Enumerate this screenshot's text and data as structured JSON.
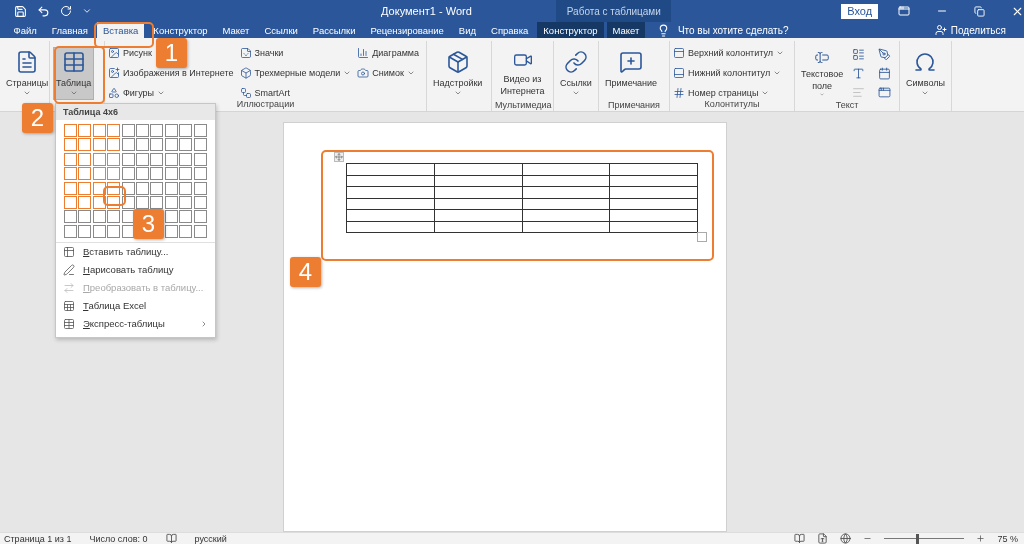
{
  "title_bar": {
    "title": "Документ1  -  Word",
    "context_label": "Работа с таблицами",
    "signin": "Вход"
  },
  "tabs": [
    {
      "label": "Файл",
      "selected": false,
      "context": false
    },
    {
      "label": "Главная",
      "selected": false,
      "context": false
    },
    {
      "label": "Вставка",
      "selected": true,
      "context": false
    },
    {
      "label": "Конструктор",
      "selected": false,
      "context": false
    },
    {
      "label": "Макет",
      "selected": false,
      "context": false
    },
    {
      "label": "Ссылки",
      "selected": false,
      "context": false
    },
    {
      "label": "Рассылки",
      "selected": false,
      "context": false
    },
    {
      "label": "Рецензирование",
      "selected": false,
      "context": false
    },
    {
      "label": "Вид",
      "selected": false,
      "context": false
    },
    {
      "label": "Справка",
      "selected": false,
      "context": false
    },
    {
      "label": "Конструктор",
      "selected": false,
      "context": true
    },
    {
      "label": "Макет",
      "selected": false,
      "context": true
    }
  ],
  "tell_me": "Что вы хотите сделать?",
  "share": "Поделиться",
  "ribbon_groups": [
    {
      "columns": [
        [
          {
            "kind": "large",
            "label": "Страницы",
            "caret": true,
            "pressed": false
          }
        ]
      ]
    },
    {
      "columns": [
        [
          {
            "kind": "large",
            "label": "Таблица",
            "caret": true,
            "pressed": true
          }
        ]
      ]
    },
    {
      "label": "Иллюстрации",
      "columns": [
        [
          {
            "kind": "small",
            "label": "Рисунк",
            "caret": false
          },
          {
            "kind": "small",
            "label": "Изображения в Интернете",
            "caret": false
          },
          {
            "kind": "small",
            "label": "Фигуры",
            "caret": true
          }
        ],
        [
          {
            "kind": "small",
            "label": "Значки",
            "caret": false
          },
          {
            "kind": "small",
            "label": "Трехмерные модели",
            "caret": true
          },
          {
            "kind": "small",
            "label": "SmartArt",
            "caret": false
          }
        ],
        [
          {
            "kind": "small",
            "label": "Диаграмма",
            "caret": false
          },
          {
            "kind": "small",
            "label": "Снимок",
            "caret": true
          }
        ]
      ]
    },
    {
      "columns": [
        [
          {
            "kind": "large",
            "label": "Надстройки",
            "caret": true,
            "pressed": false
          }
        ]
      ]
    },
    {
      "label": "Мультимедиа",
      "columns": [
        [
          {
            "kind": "large",
            "label": "Видео из Интернета",
            "caret": false,
            "pressed": false
          }
        ]
      ]
    },
    {
      "columns": [
        [
          {
            "kind": "large",
            "label": "Ссылки",
            "caret": true,
            "pressed": false
          }
        ]
      ]
    },
    {
      "label": "Примечания",
      "columns": [
        [
          {
            "kind": "large",
            "label": "Примечание",
            "caret": false,
            "pressed": false
          }
        ]
      ]
    },
    {
      "label": "Колонтитулы",
      "columns": [
        [
          {
            "kind": "small",
            "label": "Верхний колонтитул",
            "caret": true
          },
          {
            "kind": "small",
            "label": "Нижний колонтитул",
            "caret": true
          },
          {
            "kind": "small",
            "label": "Номер страницы",
            "caret": true
          }
        ]
      ]
    },
    {
      "label": "Текст",
      "columns": [
        [
          {
            "kind": "large",
            "label": "Текстовое поле",
            "caret": true,
            "pressed": false
          }
        ],
        [
          {
            "kind": "icons"
          }
        ]
      ]
    },
    {
      "columns": [
        [
          {
            "kind": "large",
            "label": "Символы",
            "caret": true,
            "pressed": false
          }
        ]
      ]
    }
  ],
  "table_menu": {
    "header": "Таблица 4x6",
    "grid_rows": [
      {
        "cells": [
          {
            "selected": true
          },
          {
            "selected": true
          },
          {
            "selected": true
          },
          {
            "selected": true
          },
          {
            "selected": false
          },
          {
            "selected": false
          },
          {
            "selected": false
          },
          {
            "selected": false
          },
          {
            "selected": false
          },
          {
            "selected": false
          }
        ]
      },
      {
        "cells": [
          {
            "selected": true
          },
          {
            "selected": true
          },
          {
            "selected": true
          },
          {
            "selected": true
          },
          {
            "selected": false
          },
          {
            "selected": false
          },
          {
            "selected": false
          },
          {
            "selected": false
          },
          {
            "selected": false
          },
          {
            "selected": false
          }
        ]
      },
      {
        "cells": [
          {
            "selected": true
          },
          {
            "selected": true
          },
          {
            "selected": true
          },
          {
            "selected": true
          },
          {
            "selected": false
          },
          {
            "selected": false
          },
          {
            "selected": false
          },
          {
            "selected": false
          },
          {
            "selected": false
          },
          {
            "selected": false
          }
        ]
      },
      {
        "cells": [
          {
            "selected": true
          },
          {
            "selected": true
          },
          {
            "selected": true
          },
          {
            "selected": true
          },
          {
            "selected": false
          },
          {
            "selected": false
          },
          {
            "selected": false
          },
          {
            "selected": false
          },
          {
            "selected": false
          },
          {
            "selected": false
          }
        ]
      },
      {
        "cells": [
          {
            "selected": true
          },
          {
            "selected": true
          },
          {
            "selected": true
          },
          {
            "selected": true
          },
          {
            "selected": false
          },
          {
            "selected": false
          },
          {
            "selected": false
          },
          {
            "selected": false
          },
          {
            "selected": false
          },
          {
            "selected": false
          }
        ]
      },
      {
        "cells": [
          {
            "selected": true
          },
          {
            "selected": true
          },
          {
            "selected": true
          },
          {
            "selected": true
          },
          {
            "selected": false
          },
          {
            "selected": false
          },
          {
            "selected": false
          },
          {
            "selected": false
          },
          {
            "selected": false
          },
          {
            "selected": false
          }
        ]
      },
      {
        "cells": [
          {
            "selected": false
          },
          {
            "selected": false
          },
          {
            "selected": false
          },
          {
            "selected": false
          },
          {
            "selected": false
          },
          {},
          {},
          {
            "selected": false
          },
          {
            "selected": false
          },
          {
            "selected": false
          }
        ]
      },
      {
        "cells": [
          {
            "selected": false
          },
          {
            "selected": false
          },
          {
            "selected": false
          },
          {
            "selected": false
          },
          {
            "selected": false
          },
          {},
          {},
          {
            "selected": false
          },
          {
            "selected": false
          },
          {
            "selected": false
          }
        ]
      }
    ],
    "items": [
      {
        "label": "Вставить таблицу...",
        "disabled": false,
        "submenu": false
      },
      {
        "label": "Нарисовать таблицу",
        "disabled": false,
        "submenu": false
      },
      {
        "label": "Преобразовать в таблицу...",
        "disabled": true,
        "submenu": false
      },
      {
        "label": "Таблица Excel",
        "disabled": false,
        "submenu": false
      },
      {
        "label": "Экспресс-таблицы",
        "disabled": false,
        "submenu": true
      }
    ]
  },
  "callouts": [
    {
      "number": "1"
    },
    {
      "number": "2"
    },
    {
      "number": "3"
    },
    {
      "number": "4"
    }
  ],
  "status_bar": {
    "page": "Страница 1 из 1",
    "words": "Число слов: 0",
    "language": "русский",
    "zoom": "75 %",
    "zoom_slider": {
      "level": 0.41
    }
  }
}
